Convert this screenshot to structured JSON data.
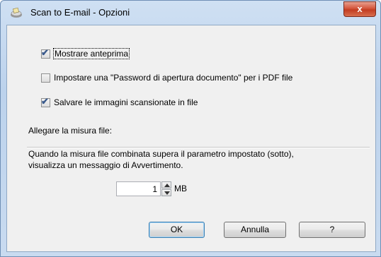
{
  "window": {
    "title": "Scan to E-mail - Opzioni",
    "close_glyph": "x",
    "icon": "scanner-app-icon"
  },
  "options": [
    {
      "label": "Mostrare anteprima",
      "checked": true
    },
    {
      "label": "Impostare una \"Password di apertura documento\" per i PDF file",
      "checked": false
    },
    {
      "label": "Salvare le immagini scansionate in file",
      "checked": true
    }
  ],
  "attach_size": {
    "heading": "Allegare la misura file:",
    "description_line1": "Quando la misura file combinata supera il parametro impostato (sotto),",
    "description_line2": "visualizza un messaggio di Avvertimento.",
    "value": "1",
    "unit": "MB"
  },
  "buttons": {
    "ok": "OK",
    "cancel": "Annulla",
    "help": "?"
  },
  "colors": {
    "titlebar": "#c9dbf0",
    "close": "#c23d22",
    "checkmark": "#3a5a8c"
  }
}
